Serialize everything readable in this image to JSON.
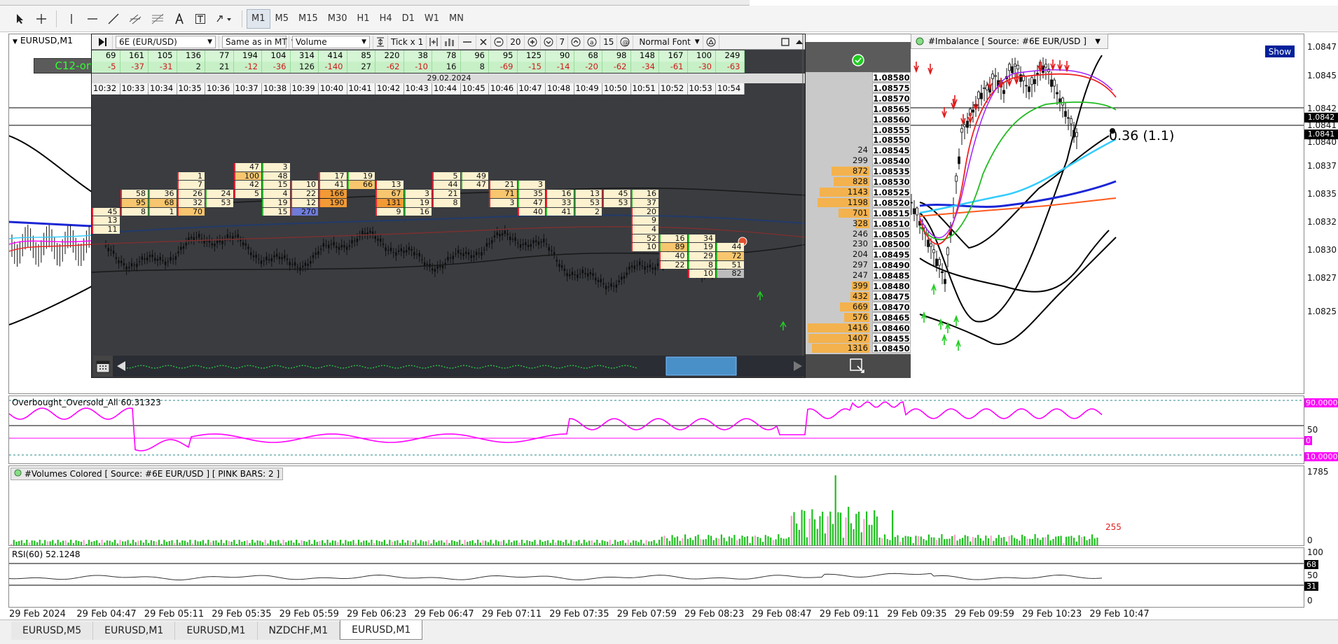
{
  "window": {
    "symbol_label": "EURUSD,M1",
    "c12_label": "C12-on"
  },
  "toolbar": {
    "timeframes": [
      "M1",
      "M5",
      "M15",
      "M30",
      "H1",
      "H4",
      "D1",
      "W1",
      "MN"
    ],
    "active_timeframe": "M1"
  },
  "orderflow": {
    "instrument": "6E (EUR/USD)",
    "mode": "Same as in MT",
    "metric": "Volume",
    "tick": "Tick x 1",
    "zoom": "20",
    "level": "7",
    "size": "15",
    "font": "Normal Font",
    "date": "29.02.2024",
    "delta_top": [
      "69",
      "161",
      "105",
      "136",
      "77",
      "194",
      "104",
      "314",
      "414",
      "85",
      "220",
      "38",
      "78",
      "96",
      "95",
      "125",
      "90",
      "68",
      "98",
      "148",
      "167",
      "100",
      "249"
    ],
    "delta_bottom": [
      "-5",
      "-37",
      "-31",
      "2",
      "21",
      "-12",
      "-36",
      "126",
      "-140",
      "27",
      "-62",
      "-10",
      "16",
      "8",
      "-69",
      "-15",
      "-14",
      "-20",
      "-62",
      "-34",
      "-61",
      "-30",
      "-63"
    ],
    "times": [
      "10:32",
      "10:33",
      "10:34",
      "10:35",
      "10:36",
      "10:37",
      "10:38",
      "10:39",
      "10:40",
      "10:41",
      "10:42",
      "10:43",
      "10:44",
      "10:45",
      "10:46",
      "10:47",
      "10:48",
      "10:49",
      "10:50",
      "10:51",
      "10:52",
      "10:53",
      "10:54"
    ],
    "ladder": [
      {
        "vol": "",
        "price": "1.08580"
      },
      {
        "vol": "",
        "price": "1.08575"
      },
      {
        "vol": "",
        "price": "1.08570"
      },
      {
        "vol": "",
        "price": "1.08565"
      },
      {
        "vol": "",
        "price": "1.08560"
      },
      {
        "vol": "",
        "price": "1.08555"
      },
      {
        "vol": "",
        "price": "1.08550"
      },
      {
        "vol": "24",
        "price": "1.08545"
      },
      {
        "vol": "299",
        "price": "1.08540"
      },
      {
        "vol": "872",
        "price": "1.08535"
      },
      {
        "vol": "828",
        "price": "1.08530"
      },
      {
        "vol": "1143",
        "price": "1.08525"
      },
      {
        "vol": "1198",
        "price": "1.08520"
      },
      {
        "vol": "701",
        "price": "1.08515"
      },
      {
        "vol": "328",
        "price": "1.08510"
      },
      {
        "vol": "246",
        "price": "1.08505"
      },
      {
        "vol": "230",
        "price": "1.08500"
      },
      {
        "vol": "204",
        "price": "1.08495"
      },
      {
        "vol": "297",
        "price": "1.08490"
      },
      {
        "vol": "247",
        "price": "1.08485"
      },
      {
        "vol": "399",
        "price": "1.08480"
      },
      {
        "vol": "432",
        "price": "1.08475"
      },
      {
        "vol": "669",
        "price": "1.08470"
      },
      {
        "vol": "576",
        "price": "1.08465"
      },
      {
        "vol": "1416",
        "price": "1.08460"
      },
      {
        "vol": "1407",
        "price": "1.08455"
      },
      {
        "vol": "1316",
        "price": "1.08450"
      }
    ],
    "cells": [
      {
        "c": 0,
        "r": 11,
        "a": "45",
        "b": ""
      },
      {
        "c": 0,
        "r": 12,
        "a": "13",
        "b": ""
      },
      {
        "c": 0,
        "r": 13,
        "a": "11",
        "b": ""
      },
      {
        "c": 1,
        "r": 9,
        "a": "58",
        "b": "36"
      },
      {
        "c": 1,
        "r": 10,
        "a": "95",
        "b": "68"
      },
      {
        "c": 1,
        "r": 11,
        "a": "8",
        "b": "1"
      },
      {
        "c": 3,
        "r": 7,
        "a": "1",
        "b": ""
      },
      {
        "c": 3,
        "r": 8,
        "a": "7",
        "b": ""
      },
      {
        "c": 3,
        "r": 9,
        "a": "26",
        "b": "24"
      },
      {
        "c": 3,
        "r": 10,
        "a": "32",
        "b": "53"
      },
      {
        "c": 3,
        "r": 11,
        "a": "70",
        "b": ""
      },
      {
        "c": 5,
        "r": 6,
        "a": "47",
        "b": "3"
      },
      {
        "c": 5,
        "r": 7,
        "a": "100",
        "b": "48"
      },
      {
        "c": 5,
        "r": 8,
        "a": "42",
        "b": "15"
      },
      {
        "c": 5,
        "r": 9,
        "a": "5",
        "b": "4"
      },
      {
        "c": 5,
        "r": 10,
        "a": "",
        "b": "19"
      },
      {
        "c": 5,
        "r": 11,
        "a": "",
        "b": "15"
      },
      {
        "c": 7,
        "r": 8,
        "a": "10",
        "b": ""
      },
      {
        "c": 7,
        "r": 9,
        "a": "22",
        "b": ""
      },
      {
        "c": 7,
        "r": 10,
        "a": "12",
        "b": ""
      },
      {
        "c": 7,
        "r": 11,
        "a": "270",
        "b": ""
      },
      {
        "c": 8,
        "r": 7,
        "a": "17",
        "b": "19"
      },
      {
        "c": 8,
        "r": 8,
        "a": "41",
        "b": "66"
      },
      {
        "c": 8,
        "r": 9,
        "a": "166",
        "b": ""
      },
      {
        "c": 8,
        "r": 10,
        "a": "190",
        "b": ""
      },
      {
        "c": 10,
        "r": 8,
        "a": "13",
        "b": ""
      },
      {
        "c": 10,
        "r": 9,
        "a": "67",
        "b": "3"
      },
      {
        "c": 10,
        "r": 10,
        "a": "131",
        "b": "19"
      },
      {
        "c": 10,
        "r": 11,
        "a": "9",
        "b": "16"
      },
      {
        "c": 12,
        "r": 7,
        "a": "5",
        "b": "49"
      },
      {
        "c": 12,
        "r": 8,
        "a": "44",
        "b": "47"
      },
      {
        "c": 12,
        "r": 9,
        "a": "21",
        "b": ""
      },
      {
        "c": 12,
        "r": 10,
        "a": "8",
        "b": ""
      },
      {
        "c": 14,
        "r": 8,
        "a": "21",
        "b": "3"
      },
      {
        "c": 14,
        "r": 9,
        "a": "71",
        "b": "35"
      },
      {
        "c": 14,
        "r": 10,
        "a": "3",
        "b": "47"
      },
      {
        "c": 16,
        "r": 9,
        "a": "16",
        "b": "13"
      },
      {
        "c": 16,
        "r": 10,
        "a": "33",
        "b": "53"
      },
      {
        "c": 15,
        "r": 11,
        "a": "40",
        "b": "41"
      },
      {
        "c": 16,
        "r": 11,
        "a": "",
        "b": "2"
      },
      {
        "c": 18,
        "r": 9,
        "a": "45",
        "b": "16"
      },
      {
        "c": 18,
        "r": 10,
        "a": "53",
        "b": "37"
      },
      {
        "c": 19,
        "r": 11,
        "a": "20",
        "b": ""
      },
      {
        "c": 19,
        "r": 12,
        "a": "9",
        "b": ""
      },
      {
        "c": 19,
        "r": 13,
        "a": "4",
        "b": ""
      },
      {
        "c": 19,
        "r": 14,
        "a": "52",
        "b": "16"
      },
      {
        "c": 19,
        "r": 15,
        "a": "10",
        "b": "89"
      },
      {
        "c": 20,
        "r": 14,
        "a": "",
        "b": "34"
      },
      {
        "c": 20,
        "r": 15,
        "a": "",
        "b": "19"
      },
      {
        "c": 21,
        "r": 15,
        "a": "",
        "b": "44"
      },
      {
        "c": 20,
        "r": 16,
        "a": "40",
        "b": "29"
      },
      {
        "c": 21,
        "r": 16,
        "a": "",
        "b": "72"
      },
      {
        "c": 20,
        "r": 17,
        "a": "22",
        "b": "8"
      },
      {
        "c": 21,
        "r": 17,
        "a": "",
        "b": "51"
      },
      {
        "c": 21,
        "r": 18,
        "a": "10",
        "b": "82"
      }
    ]
  },
  "imbalance": {
    "title": "#Imbalance [ Source: #6E EUR/USD ]",
    "show_label": "Show",
    "annotation": "0.36 (1.1)"
  },
  "price_scale": [
    "1.0847",
    "1.0845",
    "1.0842",
    "1.0841",
    "1.0840",
    "1.0837",
    "1.0835",
    "1.0832",
    "1.0830",
    "1.0827",
    "1.0825"
  ],
  "price_tags": [
    "1.0842",
    "1.0841"
  ],
  "osc": {
    "title": "Overbought_Oversold_All 60.31323",
    "levels": [
      "90.0000",
      "50",
      "0",
      "10.0000"
    ]
  },
  "volumes": {
    "title": "#Volumes Colored [ Source: #6E EUR/USD ]  [ PINK BARS: 2 ]",
    "max": "1785",
    "min": "0",
    "last": "255"
  },
  "rsi": {
    "title": "RSI(60) 52.1248",
    "levels": [
      "100",
      "68",
      "50",
      "31",
      "0"
    ]
  },
  "time_axis": [
    "29 Feb 2024",
    "29 Feb 04:47",
    "29 Feb 05:11",
    "29 Feb 05:35",
    "29 Feb 05:59",
    "29 Feb 06:23",
    "29 Feb 06:47",
    "29 Feb 07:11",
    "29 Feb 07:35",
    "29 Feb 07:59",
    "29 Feb 08:23",
    "29 Feb 08:47",
    "29 Feb 09:11",
    "29 Feb 09:35",
    "29 Feb 09:59",
    "29 Feb 10:23",
    "29 Feb 10:47"
  ],
  "tabs": [
    {
      "label": "EURUSD,M5"
    },
    {
      "label": "EURUSD,M1"
    },
    {
      "label": "EURUSD,M1"
    },
    {
      "label": "NZDCHF,M1"
    },
    {
      "label": "EURUSD,M1"
    }
  ],
  "active_tab": 4,
  "colors": {
    "magenta": "#ff00ff",
    "dark_bg": "#3a3c40",
    "cell": "#fde9b4",
    "cell_hot": "#f5a442",
    "ladder_bar": "#f3b24d",
    "green": "#20c020",
    "pink": "#ff9fcf"
  }
}
